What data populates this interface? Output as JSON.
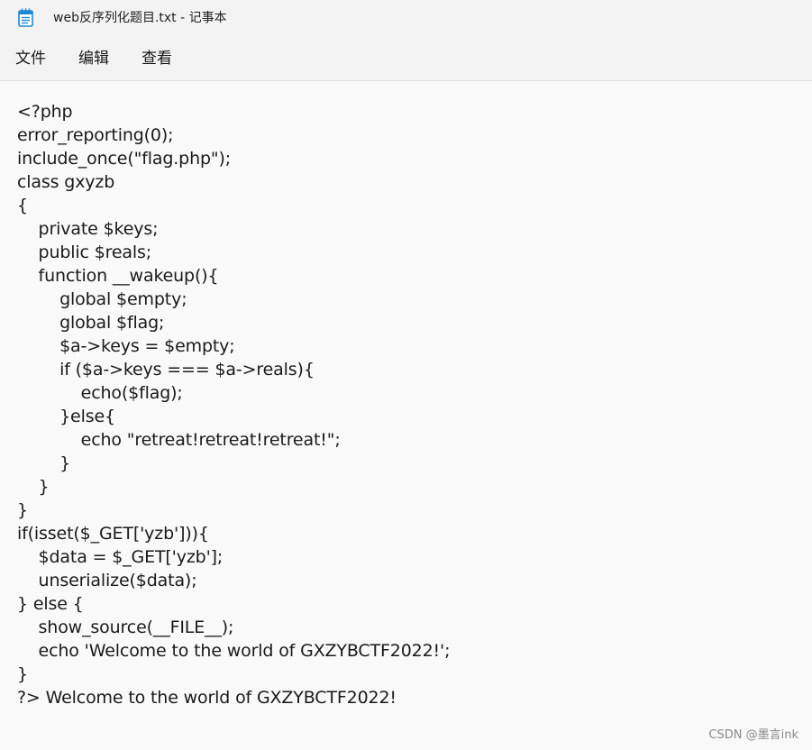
{
  "window": {
    "title": "web反序列化题目.txt - 记事本"
  },
  "menu": {
    "file": "文件",
    "edit": "编辑",
    "view": "查看"
  },
  "editor": {
    "lines": [
      "<?php",
      "error_reporting(0);",
      "include_once(\"flag.php\");",
      "class gxyzb",
      "{",
      "    private $keys;",
      "    public $reals;",
      "    function __wakeup(){",
      "        global $empty;",
      "        global $flag;",
      "        $a->keys = $empty;",
      "        if ($a->keys === $a->reals){",
      "            echo($flag);",
      "        }else{",
      "            echo \"retreat!retreat!retreat!\";",
      "        }",
      "    }",
      "}",
      "if(isset($_GET['yzb'])){",
      "    $data = $_GET['yzb'];",
      "    unserialize($data);",
      "} else {",
      "    show_source(__FILE__);",
      "    echo 'Welcome to the world of GXZYBCTF2022!';",
      "}",
      "?> Welcome to the world of GXZYBCTF2022!"
    ]
  },
  "watermark": "CSDN @墨言ink",
  "colors": {
    "chrome": "#f3f3f3",
    "editor_bg": "#f9f9f9",
    "icon_blue": "#1e88d8"
  },
  "icons": {
    "app": "notepad-icon"
  }
}
